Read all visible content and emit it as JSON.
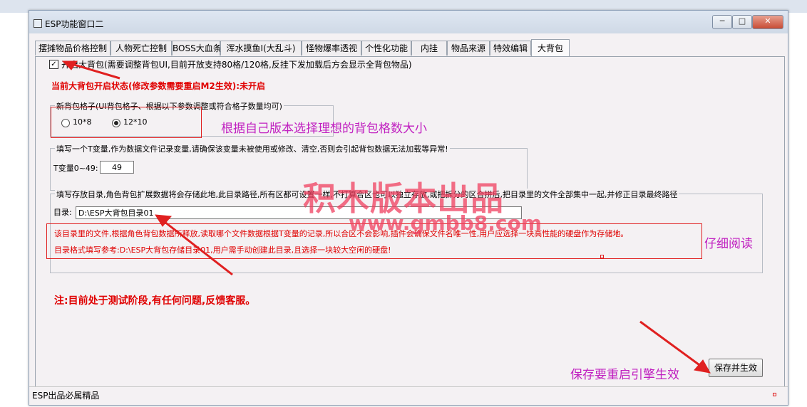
{
  "window": {
    "title": "ESP功能窗口二",
    "min_label": "─",
    "max_label": "□",
    "close_label": "✕"
  },
  "tabs": [
    {
      "label": "摆摊物品价格控制"
    },
    {
      "label": "人物死亡控制"
    },
    {
      "label": "BOSS大血条"
    },
    {
      "label": "浑水摸鱼I(大乱斗)"
    },
    {
      "label": "怪物爆率透视"
    },
    {
      "label": "个性化功能"
    },
    {
      "label": "内挂"
    },
    {
      "label": "物品来源"
    },
    {
      "label": "特效编辑"
    },
    {
      "label": "大背包",
      "active": true
    }
  ],
  "bigbag": {
    "enable_checkbox_label": "开启大背包(需要调整背包UI,目前开放支持80格/120格,反挂下发加载后方会显示全背包物品)",
    "enable_checked": "✓",
    "status_line": "当前大背包开启状态(修改参数需要重启M2生效):未开启",
    "grid_group_title": "新背包格子(UI背包格子、根据以下参数调整或符合格子数量均可)",
    "grid_options": [
      {
        "label": "10*8",
        "selected": false
      },
      {
        "label": "12*10",
        "selected": true
      }
    ],
    "grid_annotation": "根据自己版本选择理想的背包格数大小",
    "tvar_group_title": "填写一个T变量,作为数据文件记录变量,请确保该变量未被使用或修改、清空,否则会引起背包数据无法加载等异常!",
    "tvar_label": "T变量0~49:",
    "tvar_value": "49",
    "dir_group_title": "填写存放目录,角色背包扩展数据将会存储此地,此目录路径,所有区都可设置一样,不打算合区也可以独立存放,或把拆分的区合拼后,把目录里的文件全部集中一起,并修正目录最终路径",
    "dir_label": "目录:",
    "dir_value": "D:\\ESP大背包目录01",
    "dir_note_1": "该目录里的文件,根据角色背包数据所释放,读取哪个文件数据根据T变量的记录,所以合区不会影响,插件会确保文件名唯一性,用户应选择一块高性能的硬盘作为存储地。",
    "dir_note_2": "目录格式填写参考:D:\\ESP大背包存储目录01,用户需手动创建此目录,且选择一块较大空闲的硬盘!",
    "dir_annotation": "仔细阅读",
    "test_notice": "注:目前处于测试阶段,有任何问题,反馈客服。",
    "save_annotation": "保存要重启引擎生效",
    "save_button": "保存并生效"
  },
  "watermark": {
    "line1": "积木版本出品",
    "line2": "www.gmbb8.com"
  },
  "statusbar": {
    "text": "ESP出品必属精品"
  },
  "colors": {
    "annotation_red": "#e02020",
    "annotation_magenta": "#c020c0",
    "warning_red": "#e00000"
  }
}
